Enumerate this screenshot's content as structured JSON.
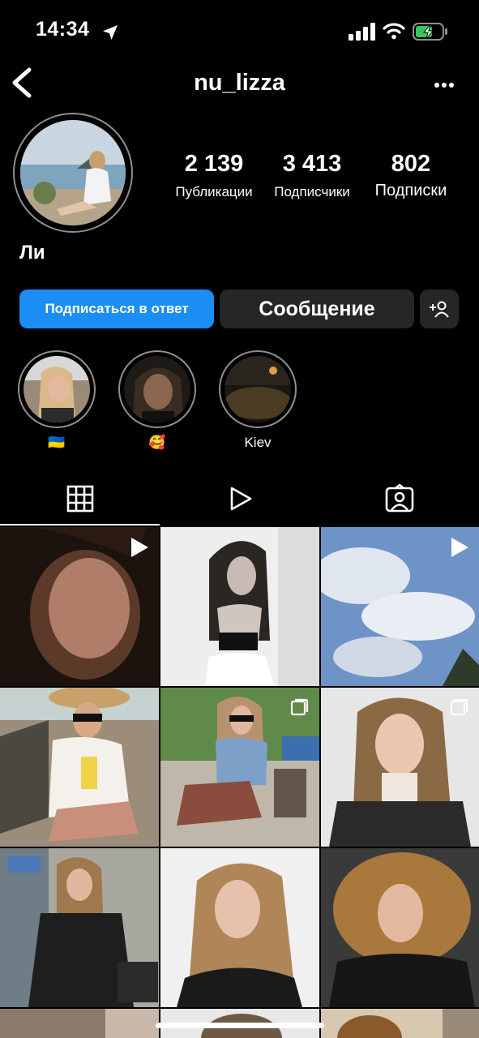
{
  "status_bar": {
    "time": "14:34"
  },
  "header": {
    "username": "nu_lizza",
    "back_icon": "chevron-left-icon",
    "more_icon": "more-horizontal-icon"
  },
  "profile": {
    "display_name": "Ли",
    "stats": [
      {
        "value": "2 139",
        "label": "Публикации"
      },
      {
        "value": "3 413",
        "label": "Подписчики"
      },
      {
        "value": "802",
        "label": "Подписки"
      }
    ]
  },
  "actions": {
    "follow_back": "Подписаться в ответ",
    "message": "Сообщение",
    "add_friend_icon": "person-add-icon"
  },
  "highlights": [
    {
      "label": "🇺🇦"
    },
    {
      "label": "🥰"
    },
    {
      "label": "Kiev"
    }
  ],
  "tabs": [
    {
      "icon": "grid-icon",
      "active": true
    },
    {
      "icon": "reels-play-icon",
      "active": false
    },
    {
      "icon": "tagged-person-icon",
      "active": false
    }
  ],
  "colors": {
    "accent": "#1a8ef5",
    "button_gray": "#262626"
  }
}
